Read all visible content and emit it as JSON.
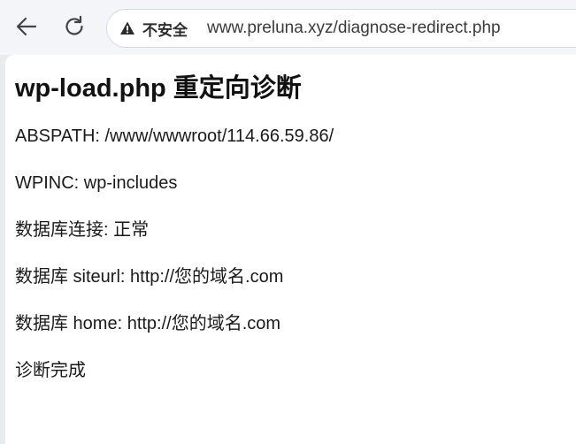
{
  "browser": {
    "security_label": "不安全",
    "url": "www.preluna.xyz/diagnose-redirect.php"
  },
  "page": {
    "title": "wp-load.php 重定向诊断",
    "lines": [
      "ABSPATH: /www/wwwroot/114.66.59.86/",
      "WPINC: wp-includes",
      "数据库连接: 正常",
      "数据库 siteurl: http://您的域名.com",
      "数据库 home: http://您的域名.com",
      "诊断完成"
    ]
  },
  "icons": {
    "back": "arrow-left-icon",
    "reload": "reload-icon",
    "security": "warning-triangle-icon"
  },
  "colors": {
    "toolbar_bg": "#f3f5f8",
    "page_bg": "#ffffff",
    "text": "#1a1a1a"
  }
}
